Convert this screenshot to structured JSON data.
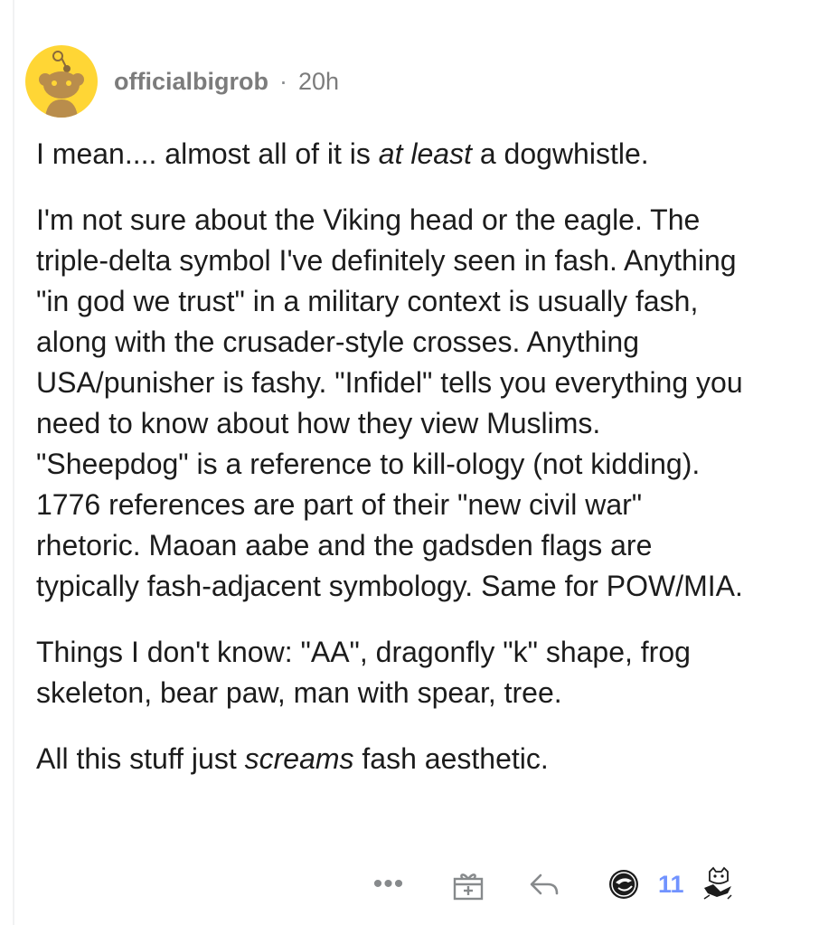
{
  "comment": {
    "username": "officialbigrob",
    "separator": "·",
    "time": "20h",
    "paragraphs": {
      "p1": {
        "before": "I mean.... almost all of it is ",
        "em": "at least",
        "after": " a dogwhistle."
      },
      "p2": "I'm not sure about the Viking head or the eagle. The triple-delta symbol I've definitely seen in fash.  Anything \"in god we trust\" in a military context is usually fash, along with the crusader-style crosses.  Anything USA/punisher is fashy. \"Infidel\" tells you everything you need to know about how they view Muslims.  \"Sheepdog\" is a reference to kill-ology (not kidding).  1776 references are part of their \"new civil war\" rhetoric. Maoan aabe and the gadsden flags are typically fash-adjacent symbology.  Same for POW/MIA.",
      "p3": "Things I don't know: \"AA\", dragonfly \"k\" shape, frog skeleton, bear paw, man with spear, tree.",
      "p4": {
        "before": "All this stuff just ",
        "em": "screams",
        "after": " fash aesthetic."
      }
    }
  },
  "actions": {
    "more_label": "•••",
    "award_count": "11",
    "icons": [
      "more-icon",
      "gift-icon",
      "reply-icon",
      "award-icon",
      "cat-award-icon"
    ]
  },
  "colors": {
    "avatar_bg": "#ffd635",
    "meta_text": "#7c7c7c",
    "count": "#7193ff"
  }
}
